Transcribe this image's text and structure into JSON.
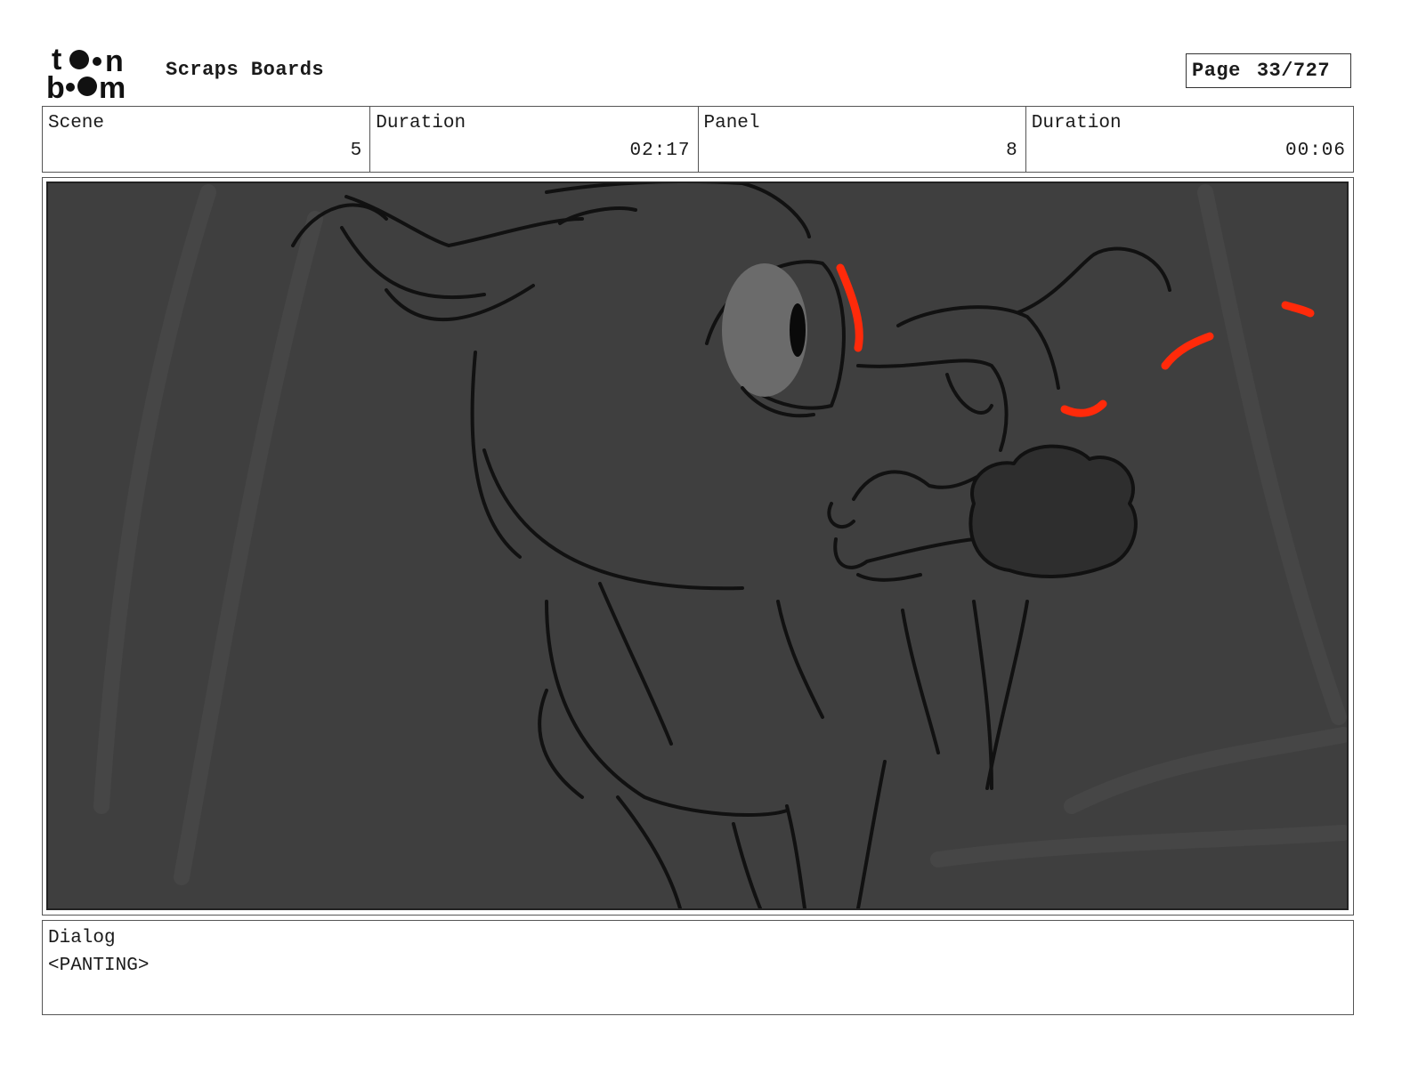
{
  "header": {
    "logo_text": "toon boom",
    "title": "Scraps Boards",
    "page_label": "Page",
    "page_number": "33/727"
  },
  "info": {
    "scene_label": "Scene",
    "scene_value": "5",
    "scene_duration_label": "Duration",
    "scene_duration_value": "02:17",
    "panel_label": "Panel",
    "panel_value": "8",
    "panel_duration_label": "Duration",
    "panel_duration_value": "00:06"
  },
  "panel": {
    "image_icon": "storyboard-sketch",
    "background_color": "#3f3f3f",
    "line_color": "#111111",
    "accent_color": "#ff2a0a"
  },
  "dialog": {
    "label": "Dialog",
    "text": "<PANTING>"
  }
}
